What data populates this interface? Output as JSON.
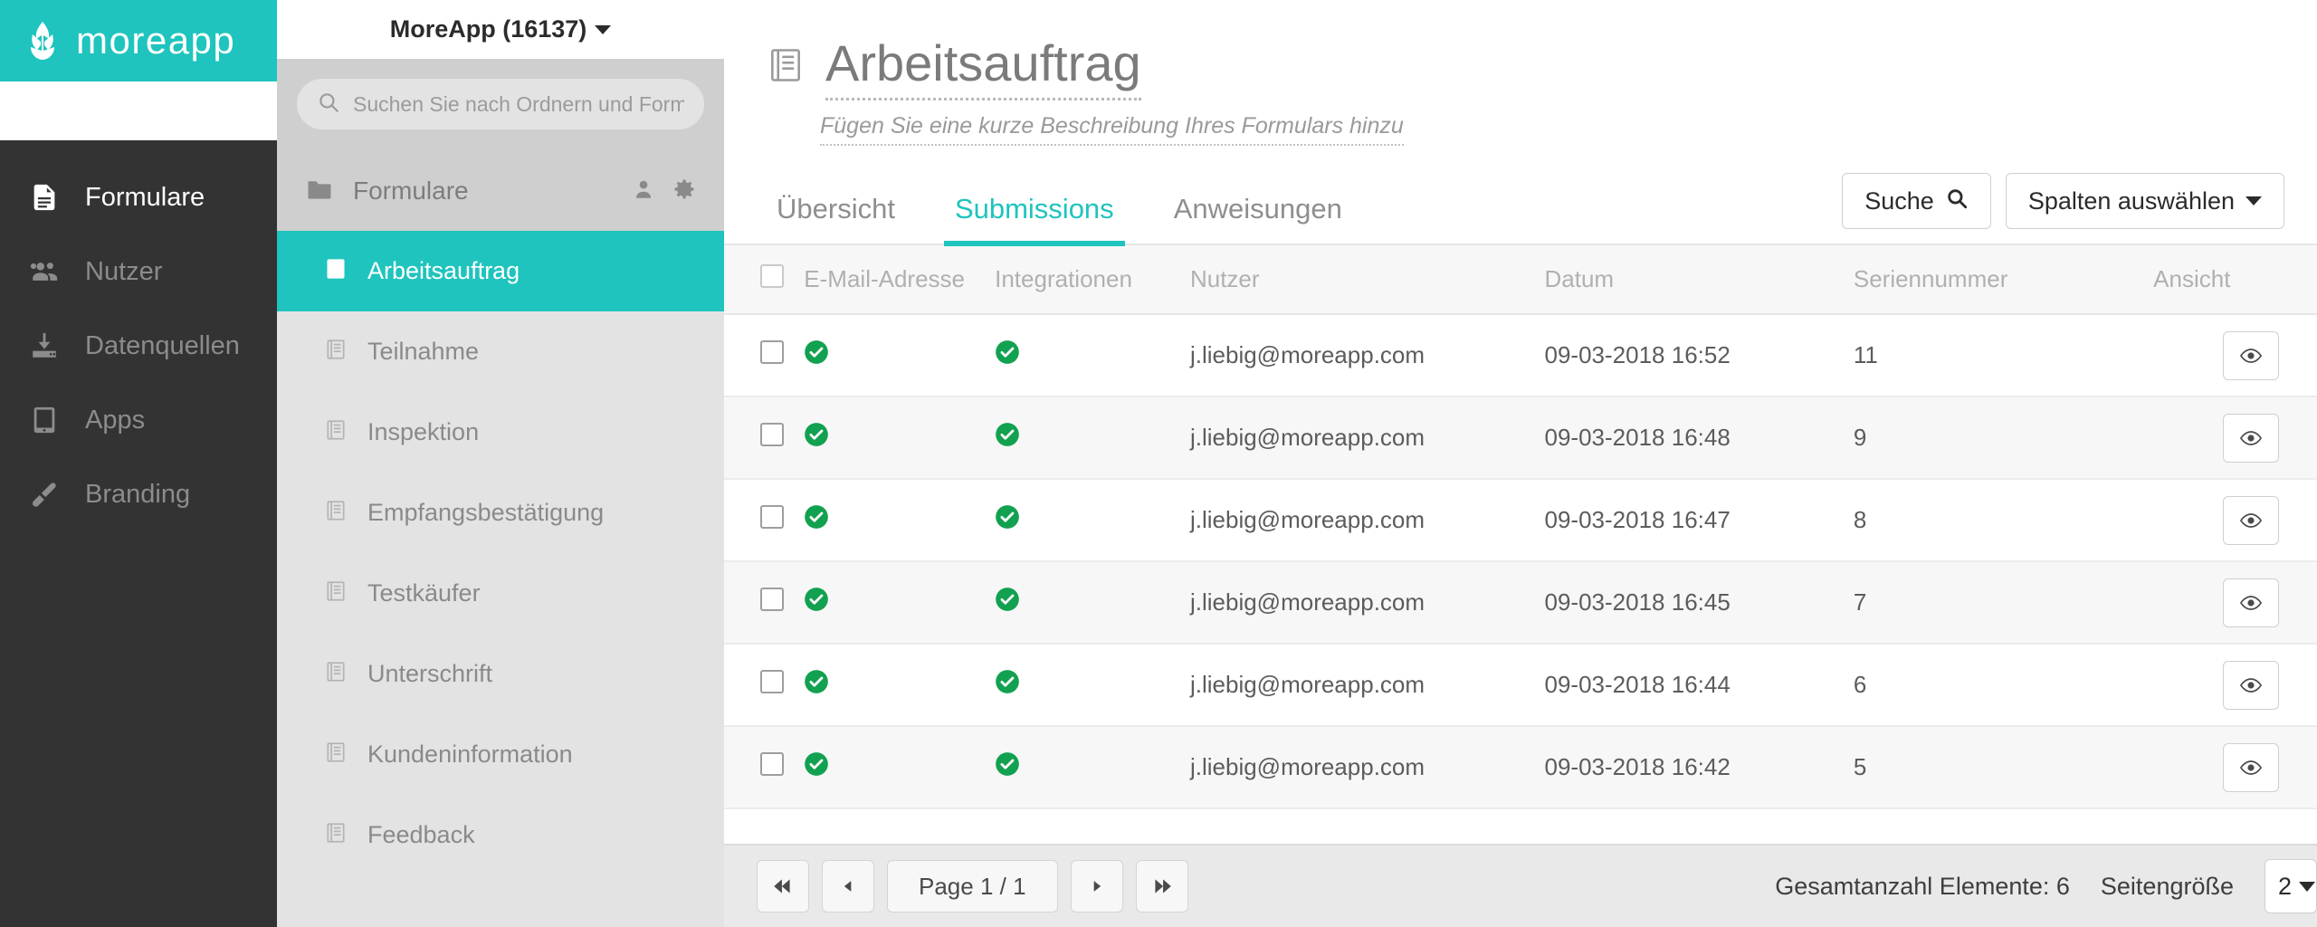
{
  "brand": {
    "name": "moreapp",
    "logo_icon": "leaf-logo-icon",
    "accent": "#1ec4bd"
  },
  "account": {
    "label": "MoreApp (16137)",
    "caret_icon": "chevron-down-icon"
  },
  "sidebar": {
    "items": [
      {
        "label": "Formulare",
        "icon": "document-icon",
        "active": true
      },
      {
        "label": "Nutzer",
        "icon": "users-icon",
        "active": false
      },
      {
        "label": "Datenquellen",
        "icon": "download-icon",
        "active": false
      },
      {
        "label": "Apps",
        "icon": "tablet-icon",
        "active": false
      },
      {
        "label": "Branding",
        "icon": "brush-icon",
        "active": false
      }
    ]
  },
  "forms_panel": {
    "search": {
      "placeholder": "Suchen Sie nach Ordnern und Formularen",
      "value": "",
      "icon": "search-icon"
    },
    "folder": {
      "label": "Formulare",
      "icon": "folder-icon",
      "actions": [
        "user-icon",
        "gear-icon"
      ]
    },
    "forms": [
      {
        "label": "Arbeitsauftrag",
        "icon": "form-icon",
        "selected": true
      },
      {
        "label": "Teilnahme",
        "icon": "form-icon",
        "selected": false
      },
      {
        "label": "Inspektion",
        "icon": "form-icon",
        "selected": false
      },
      {
        "label": "Empfangsbestätigung",
        "icon": "form-icon",
        "selected": false
      },
      {
        "label": "Testkäufer",
        "icon": "form-icon",
        "selected": false
      },
      {
        "label": "Unterschrift",
        "icon": "form-icon",
        "selected": false
      },
      {
        "label": "Kundeninformation",
        "icon": "form-icon",
        "selected": false
      },
      {
        "label": "Feedback",
        "icon": "form-icon",
        "selected": false
      }
    ]
  },
  "main": {
    "title": "Arbeitsauftrag",
    "title_icon": "form-icon",
    "subtitle": "Fügen Sie eine kurze Beschreibung Ihres Formulars hinzu",
    "tabs": [
      {
        "label": "Übersicht",
        "active": false
      },
      {
        "label": "Submissions",
        "active": true
      },
      {
        "label": "Anweisungen",
        "active": false
      }
    ],
    "buttons": {
      "search": {
        "label": "Suche",
        "icon": "search-icon"
      },
      "columns": {
        "label": "Spalten auswählen",
        "icon": "chevron-down-icon"
      }
    },
    "table": {
      "columns": [
        "",
        "E-Mail-Adresse",
        "Integrationen",
        "Nutzer",
        "Datum",
        "Seriennummer",
        "Ansicht"
      ],
      "rows": [
        {
          "checked": false,
          "email_status": "check-circle-green",
          "integration_status": "check-circle-green",
          "user": "j.liebig@moreapp.com",
          "date": "09-03-2018 16:52",
          "serial": "11",
          "view_icon": "eye-icon"
        },
        {
          "checked": false,
          "email_status": "check-circle-green",
          "integration_status": "check-circle-green",
          "user": "j.liebig@moreapp.com",
          "date": "09-03-2018 16:48",
          "serial": "9",
          "view_icon": "eye-icon"
        },
        {
          "checked": false,
          "email_status": "check-circle-green",
          "integration_status": "check-circle-green",
          "user": "j.liebig@moreapp.com",
          "date": "09-03-2018 16:47",
          "serial": "8",
          "view_icon": "eye-icon"
        },
        {
          "checked": false,
          "email_status": "check-circle-green",
          "integration_status": "check-circle-green",
          "user": "j.liebig@moreapp.com",
          "date": "09-03-2018 16:45",
          "serial": "7",
          "view_icon": "eye-icon"
        },
        {
          "checked": false,
          "email_status": "check-circle-green",
          "integration_status": "check-circle-green",
          "user": "j.liebig@moreapp.com",
          "date": "09-03-2018 16:44",
          "serial": "6",
          "view_icon": "eye-icon"
        },
        {
          "checked": false,
          "email_status": "check-circle-green",
          "integration_status": "check-circle-green",
          "user": "j.liebig@moreapp.com",
          "date": "09-03-2018 16:42",
          "serial": "5",
          "view_icon": "eye-icon"
        }
      ]
    },
    "footer": {
      "first_icon": "skip-first-icon",
      "prev_icon": "prev-icon",
      "page_label": "Page 1 / 1",
      "next_icon": "next-icon",
      "last_icon": "skip-last-icon",
      "total_label": "Gesamtanzahl Elemente: 6",
      "page_size_label": "Seitengröße",
      "page_size_value": "2"
    }
  },
  "colors": {
    "accent": "#1ec4bd",
    "status_green": "#12a150",
    "nav_dark": "#333333"
  }
}
